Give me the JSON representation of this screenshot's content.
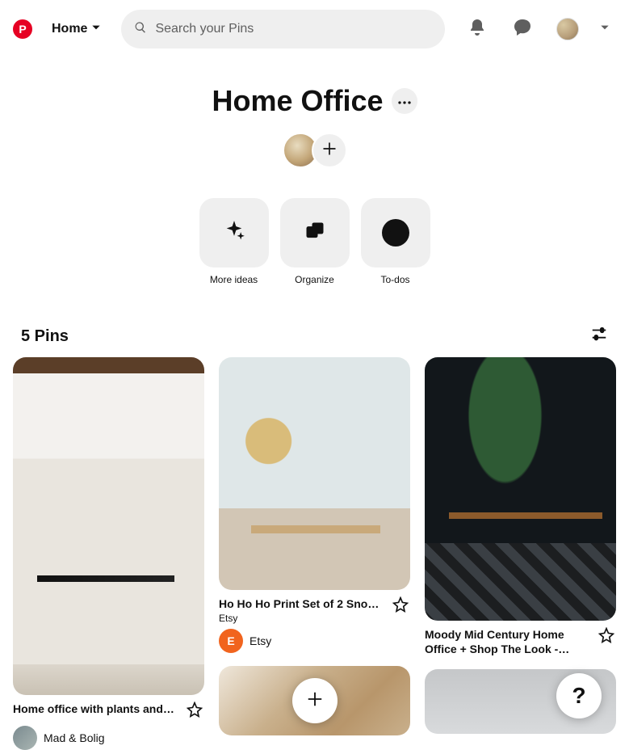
{
  "header": {
    "home_label": "Home",
    "search_placeholder": "Search your Pins"
  },
  "board": {
    "title": "Home Office",
    "actions": {
      "more_ideas": "More ideas",
      "organize": "Organize",
      "todos": "To-dos"
    }
  },
  "pin_count_label": "5 Pins",
  "pins": [
    {
      "title": "Home office with plants and…",
      "source": "Mad & Bolig"
    },
    {
      "title": "Ho Ho Ho Print Set of 2 Sno…",
      "subtitle": "Etsy",
      "source": "Etsy"
    },
    {
      "title": "Moody Mid Century Home Office + Shop The Look -…"
    }
  ],
  "help_label": "?"
}
